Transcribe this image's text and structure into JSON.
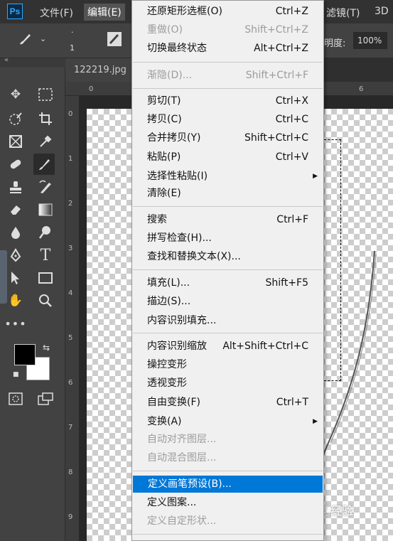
{
  "app": {
    "logo": "Ps",
    "menubar": {
      "file": "文件(F)",
      "edit": "编辑(E)",
      "filter": "滤镜(T)",
      "three_d": "3D"
    }
  },
  "options": {
    "brush_size": "1",
    "opacity_label": "明度:",
    "opacity_value": "100%"
  },
  "document": {
    "tab_title": "122219.jpg",
    "ruler_top": [
      "0",
      "6"
    ],
    "ruler_left": [
      "0",
      "1",
      "2",
      "3",
      "4",
      "5",
      "6",
      "7",
      "8",
      "9"
    ]
  },
  "edit_menu": {
    "items": [
      {
        "label": "还原矩形选框(O)",
        "shortcut": "Ctrl+Z",
        "enabled": true
      },
      {
        "label": "重做(O)",
        "shortcut": "Shift+Ctrl+Z",
        "enabled": false
      },
      {
        "label": "切换最终状态",
        "shortcut": "Alt+Ctrl+Z",
        "enabled": true
      },
      {
        "label": "渐隐(D)...",
        "shortcut": "Shift+Ctrl+F",
        "enabled": false
      },
      {
        "label": "剪切(T)",
        "shortcut": "Ctrl+X",
        "enabled": true
      },
      {
        "label": "拷贝(C)",
        "shortcut": "Ctrl+C",
        "enabled": true
      },
      {
        "label": "合并拷贝(Y)",
        "shortcut": "Shift+Ctrl+C",
        "enabled": true
      },
      {
        "label": "粘贴(P)",
        "shortcut": "Ctrl+V",
        "enabled": true
      },
      {
        "label": "选择性粘贴(I)",
        "shortcut": "",
        "enabled": true,
        "submenu": true
      },
      {
        "label": "清除(E)",
        "shortcut": "",
        "enabled": true
      },
      {
        "label": "搜索",
        "shortcut": "Ctrl+F",
        "enabled": true
      },
      {
        "label": "拼写检查(H)...",
        "shortcut": "",
        "enabled": true
      },
      {
        "label": "查找和替换文本(X)...",
        "shortcut": "",
        "enabled": true
      },
      {
        "label": "填充(L)...",
        "shortcut": "Shift+F5",
        "enabled": true
      },
      {
        "label": "描边(S)...",
        "shortcut": "",
        "enabled": true
      },
      {
        "label": "内容识别填充...",
        "shortcut": "",
        "enabled": true
      },
      {
        "label": "内容识别缩放",
        "shortcut": "Alt+Shift+Ctrl+C",
        "enabled": true
      },
      {
        "label": "操控变形",
        "shortcut": "",
        "enabled": true
      },
      {
        "label": "透视变形",
        "shortcut": "",
        "enabled": true
      },
      {
        "label": "自由变换(F)",
        "shortcut": "Ctrl+T",
        "enabled": true
      },
      {
        "label": "变换(A)",
        "shortcut": "",
        "enabled": true,
        "submenu": true
      },
      {
        "label": "自动对齐图层...",
        "shortcut": "",
        "enabled": false
      },
      {
        "label": "自动混合图层...",
        "shortcut": "",
        "enabled": false
      },
      {
        "label": "定义画笔预设(B)...",
        "shortcut": "",
        "enabled": true,
        "highlighted": true
      },
      {
        "label": "定义图案...",
        "shortcut": "",
        "enabled": true
      },
      {
        "label": "定义自定形状...",
        "shortcut": "",
        "enabled": false
      }
    ]
  },
  "watermark": "Bai度 经验",
  "colors": {
    "highlight": "#0078d7",
    "menu_bg": "#f0f0f0",
    "foreground_swatch": "#000000",
    "background_swatch": "#ffffff"
  }
}
